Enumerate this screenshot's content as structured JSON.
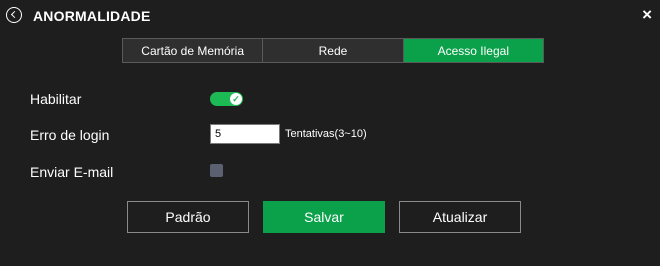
{
  "header": {
    "title": "ANORMALIDADE",
    "close_label": "×"
  },
  "tabs": [
    {
      "label": "Cartão de Memória",
      "active": false
    },
    {
      "label": "Rede",
      "active": false
    },
    {
      "label": "Acesso Ilegal",
      "active": true
    }
  ],
  "form": {
    "enable_label": "Habilitar",
    "enable_value": true,
    "login_error_label": "Erro de login",
    "login_error_value": "5",
    "login_error_hint": "Tentativas(3~10)",
    "send_email_label": "Enviar E-mail",
    "send_email_value": false
  },
  "buttons": {
    "default_label": "Padrão",
    "save_label": "Salvar",
    "refresh_label": "Atualizar"
  },
  "colors": {
    "accent": "#0ba14a",
    "background": "#1e1e1e",
    "checkbox": "#5b6170"
  },
  "icons": {
    "back": "back-circle-icon",
    "close": "close-icon",
    "toggle_check": "check-icon"
  }
}
